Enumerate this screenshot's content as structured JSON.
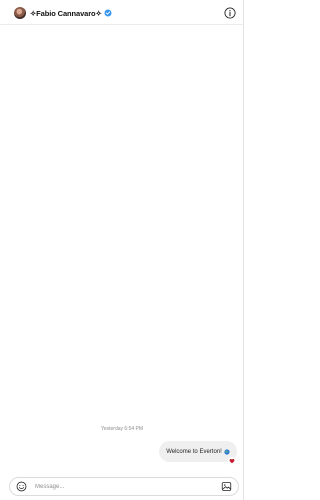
{
  "header": {
    "username": "✧Fabio Cannavaro✧",
    "verified": true,
    "avatar_alt": "avatar"
  },
  "conversation": {
    "timestamp": "Yesterday 6:54 PM",
    "messages": [
      {
        "text": "Welcome to Everton!",
        "sender": "self",
        "emoji_icon": "globe-icon",
        "reaction_icon": "heart-icon"
      }
    ]
  },
  "composer": {
    "placeholder": "Message..."
  },
  "colors": {
    "verified": "#3897f0",
    "heart": "#c2182b",
    "bubble_bg": "#efefef",
    "border": "#dbdbdb"
  }
}
